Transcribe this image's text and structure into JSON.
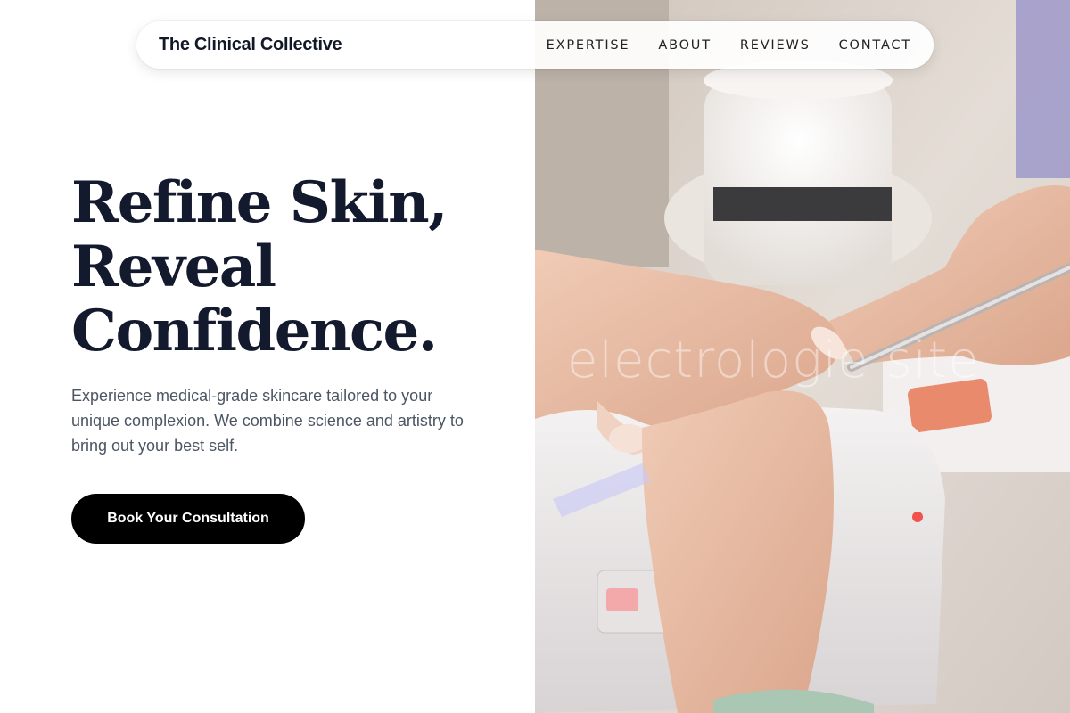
{
  "brand": {
    "name": "The Clinical Collective"
  },
  "nav": {
    "items": [
      {
        "label": "EXPERTISE"
      },
      {
        "label": "ABOUT"
      },
      {
        "label": "REVIEWS"
      },
      {
        "label": "CONTACT"
      }
    ]
  },
  "hero": {
    "title_lines": [
      "Refine Skin,",
      "Reveal",
      "Confidence."
    ],
    "subtitle": "Experience medical-grade skincare tailored to your unique complexion. We combine science and artistry to bring out your best self.",
    "cta_label": "Book Your Consultation",
    "image_watermark": "electrologie site"
  },
  "colors": {
    "title": "#141a2e",
    "body_text": "#4b5563",
    "cta_background": "#000000",
    "cta_text": "#ffffff",
    "background": "#ffffff"
  }
}
